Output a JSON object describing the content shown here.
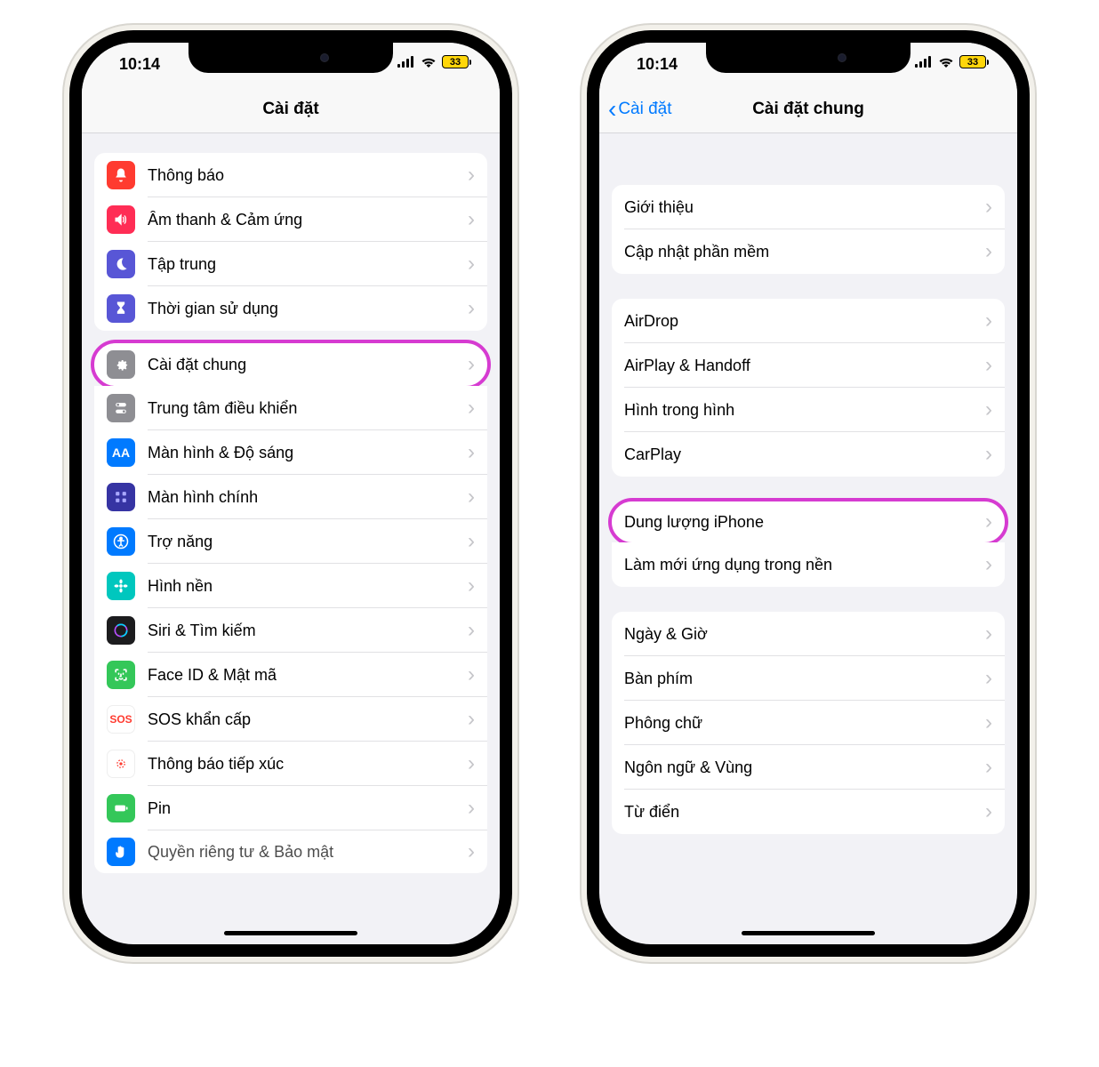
{
  "status": {
    "time": "10:14",
    "battery_pct": "33"
  },
  "left": {
    "nav_title": "Cài đặt",
    "sections": [
      {
        "items": [
          {
            "id": "notifications",
            "label": "Thông báo",
            "icon": "bell",
            "color": "#ff3b30"
          },
          {
            "id": "sounds",
            "label": "Âm thanh & Cảm ứng",
            "icon": "speaker",
            "color": "#ff2d55"
          },
          {
            "id": "focus",
            "label": "Tập trung",
            "icon": "moon",
            "color": "#5856d6"
          },
          {
            "id": "screentime",
            "label": "Thời gian sử dụng",
            "icon": "hourglass",
            "color": "#5856d6"
          }
        ]
      },
      {
        "items": [
          {
            "id": "general",
            "label": "Cài đặt chung",
            "icon": "gear",
            "color": "#8e8e93",
            "highlighted": true
          },
          {
            "id": "controlcenter",
            "label": "Trung tâm điều khiển",
            "icon": "switches",
            "color": "#8e8e93"
          },
          {
            "id": "display",
            "label": "Màn hình & Độ sáng",
            "icon": "aa",
            "color": "#007aff"
          },
          {
            "id": "homescreen",
            "label": "Màn hình chính",
            "icon": "grid",
            "color": "#3634a3"
          },
          {
            "id": "accessibility",
            "label": "Trợ năng",
            "icon": "person",
            "color": "#007aff"
          },
          {
            "id": "wallpaper",
            "label": "Hình nền",
            "icon": "flower",
            "color": "#00c7be"
          },
          {
            "id": "siri",
            "label": "Siri & Tìm kiếm",
            "icon": "siri",
            "color": "#1c1c1e"
          },
          {
            "id": "faceid",
            "label": "Face ID & Mật mã",
            "icon": "faceid",
            "color": "#34c759"
          },
          {
            "id": "sos",
            "label": "SOS khẩn cấp",
            "icon": "sos",
            "color": "#ff3b30"
          },
          {
            "id": "exposure",
            "label": "Thông báo tiếp xúc",
            "icon": "exposure",
            "color": "#ffffff"
          },
          {
            "id": "battery",
            "label": "Pin",
            "icon": "battery",
            "color": "#34c759"
          },
          {
            "id": "privacy",
            "label": "Quyền riêng tư & Bảo mật",
            "icon": "hand",
            "color": "#007aff"
          }
        ]
      }
    ]
  },
  "right": {
    "nav_title": "Cài đặt chung",
    "back_label": "Cài đặt",
    "sections": [
      {
        "items": [
          {
            "id": "about",
            "label": "Giới thiệu"
          },
          {
            "id": "update",
            "label": "Cập nhật phần mềm"
          }
        ]
      },
      {
        "items": [
          {
            "id": "airdrop",
            "label": "AirDrop"
          },
          {
            "id": "airplay",
            "label": "AirPlay & Handoff"
          },
          {
            "id": "pip",
            "label": "Hình trong hình"
          },
          {
            "id": "carplay",
            "label": "CarPlay"
          }
        ]
      },
      {
        "items": [
          {
            "id": "storage",
            "label": "Dung lượng iPhone",
            "highlighted": true
          },
          {
            "id": "bgrefresh",
            "label": "Làm mới ứng dụng trong nền"
          }
        ]
      },
      {
        "items": [
          {
            "id": "datetime",
            "label": "Ngày & Giờ"
          },
          {
            "id": "keyboard",
            "label": "Bàn phím"
          },
          {
            "id": "fonts",
            "label": "Phông chữ"
          },
          {
            "id": "language",
            "label": "Ngôn ngữ & Vùng"
          },
          {
            "id": "dictionary",
            "label": "Từ điển"
          }
        ]
      }
    ]
  }
}
